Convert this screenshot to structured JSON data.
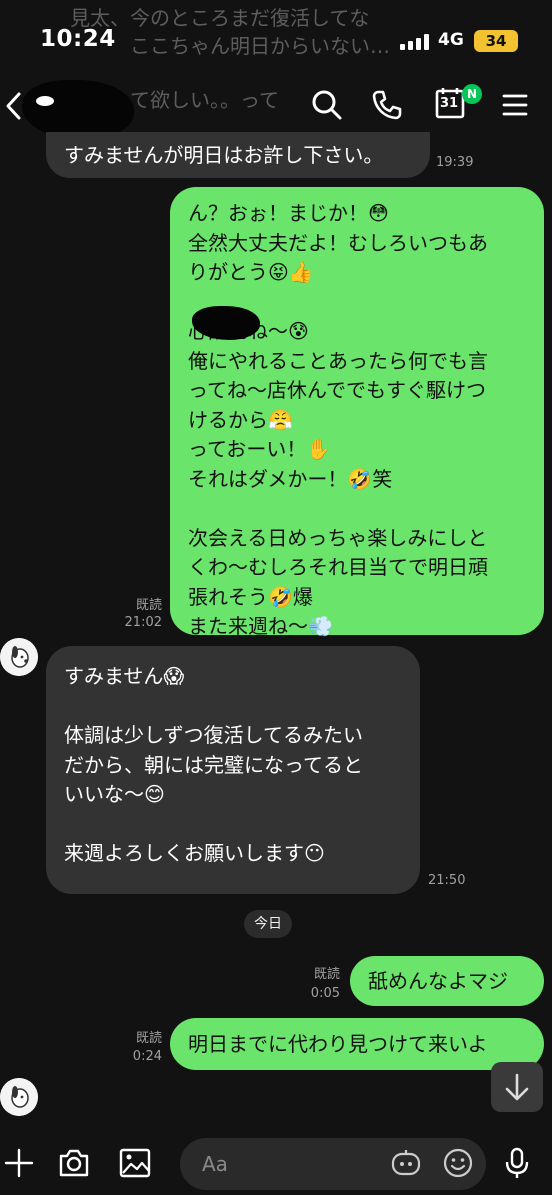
{
  "status_bar": {
    "time": "10:24",
    "network": "4G",
    "battery": "34"
  },
  "background_preview": {
    "line1": "見太、今のところまだ復活してな",
    "line2": "ここちゃん明日からいない…",
    "line3": "て欲しい。。って"
  },
  "header": {
    "calendar_day": "31",
    "calendar_badge": "N"
  },
  "messages": [
    {
      "id": "m1",
      "direction": "incoming",
      "text": "すみませんが明日はお許し下さい。",
      "time": "19:39"
    },
    {
      "id": "m2",
      "direction": "outgoing",
      "read": "既読",
      "time": "21:02",
      "text": "ん？おぉ！まじか！😳\n全然大丈夫だよ！むしろいつもあ\nりがとう😝👍\n\n心配だね〜😰\n俺にやれることあったら何でも言\nってね〜店休んででもすぐ駆けつ\nけるから😤\nっておーい！✋\nそれはダメかー！🤣笑\n\n次会える日めっちゃ楽しみにしと\nくわ〜むしろそれ目当てで明日頑\n張れそう🤣爆\nまた来週ね〜💨"
    },
    {
      "id": "m3",
      "direction": "incoming",
      "time": "21:50",
      "text": "すみません😱\n\n体調は少しずつ復活してるみたい\nだから、朝には完璧になってると\nいいな〜😊\n\n来週よろしくお願いします😶"
    },
    {
      "id": "m4",
      "direction": "outgoing",
      "read": "既読",
      "time": "0:05",
      "text": "舐めんなよマジ"
    },
    {
      "id": "m5",
      "direction": "outgoing",
      "read": "既読",
      "time": "0:24",
      "text": "明日までに代わり見つけて来いよ"
    }
  ],
  "date_separator": "今日",
  "composer": {
    "placeholder": "Aa"
  },
  "icons": {
    "back": "chevron-left-icon",
    "search": "search-icon",
    "call": "phone-icon",
    "calendar": "calendar-icon",
    "menu": "menu-icon",
    "plus": "plus-icon",
    "camera": "camera-icon",
    "image": "image-icon",
    "emoji": "emoji-icon",
    "sticker": "sticker-icon",
    "mic": "microphone-icon",
    "scroll_down": "arrow-down-icon"
  },
  "colors": {
    "background": "#121212",
    "incoming_bubble": "#333333",
    "outgoing_bubble": "#6ae46a",
    "badge_green": "#06c755",
    "battery": "#f2c230"
  }
}
